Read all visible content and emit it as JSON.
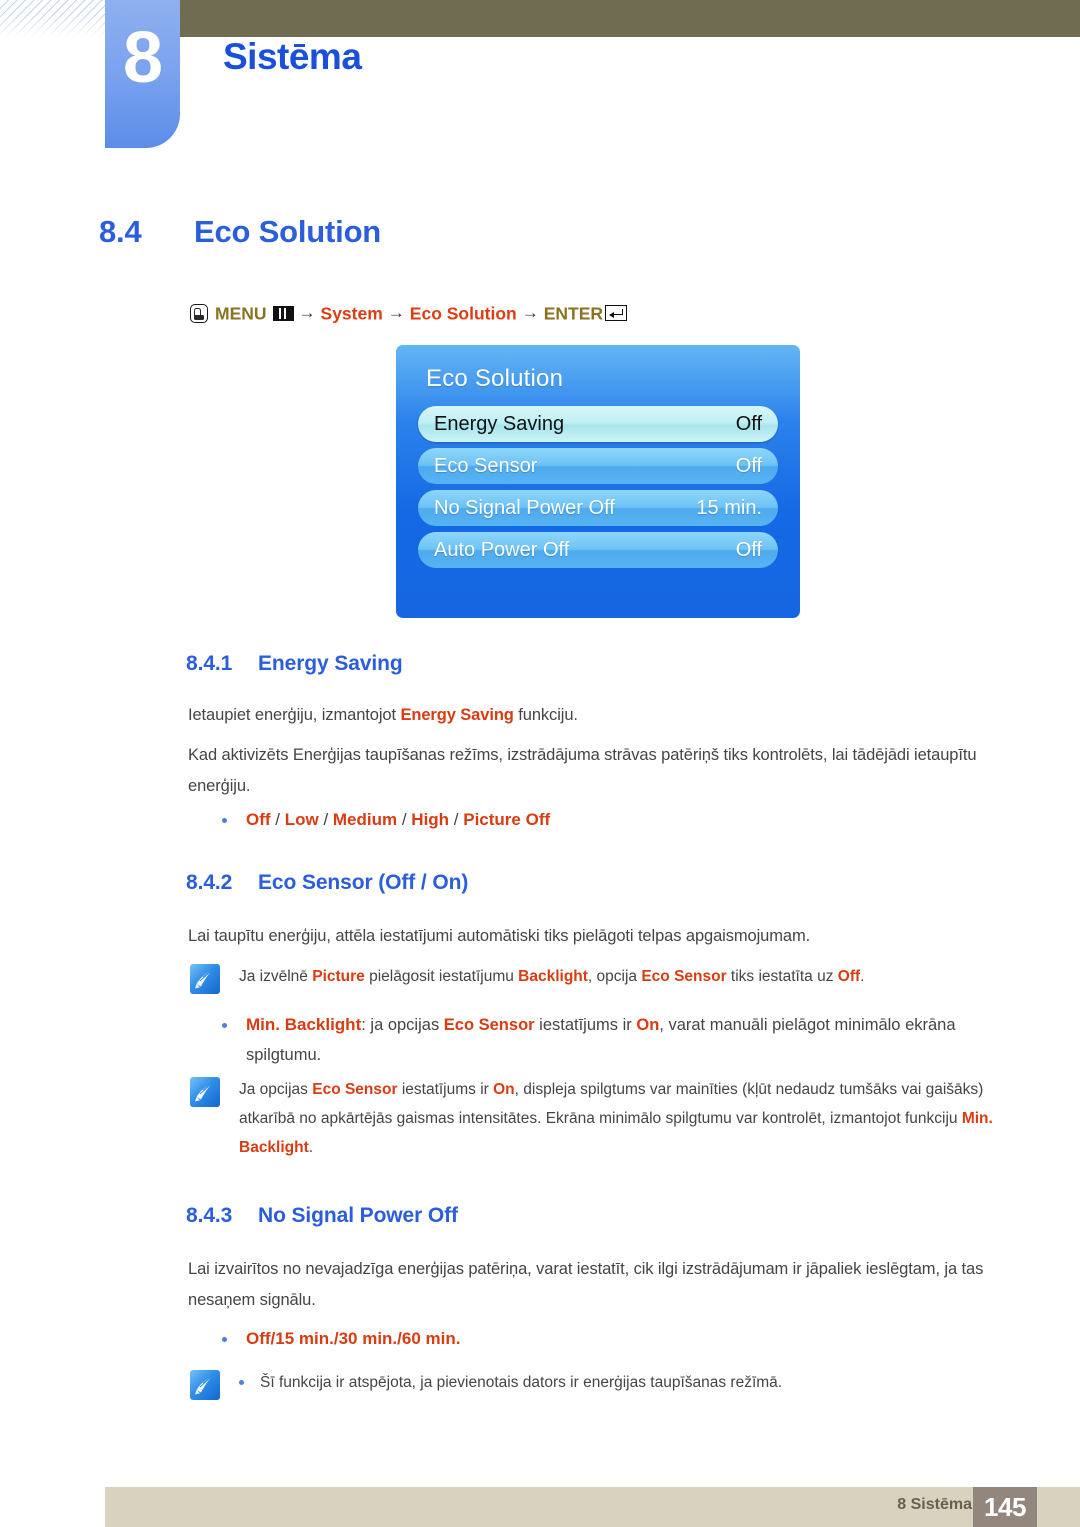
{
  "chapter": {
    "number": "8",
    "title": "Sistēma"
  },
  "section": {
    "number": "8.4",
    "title": "Eco Solution"
  },
  "menu_path": {
    "hand_icon": "hand-press-icon",
    "menu_label": "MENU",
    "menu_icon": "menu-grid-icon",
    "arrow1": "→",
    "system_label": "System",
    "arrow2": "→",
    "eco_solution_label": "Eco Solution",
    "arrow3": "→",
    "enter_label": "ENTER",
    "enter_icon": "enter-key-icon"
  },
  "osd": {
    "title": "Eco Solution",
    "rows": [
      {
        "label": "Energy Saving",
        "value": "Off",
        "selected": true
      },
      {
        "label": "Eco Sensor",
        "value": "Off",
        "selected": false
      },
      {
        "label": "No Signal Power Off",
        "value": "15 min.",
        "selected": false
      },
      {
        "label": "Auto Power Off",
        "value": "Off",
        "selected": false
      }
    ]
  },
  "s841": {
    "number": "8.4.1",
    "title": "Energy Saving",
    "p1_a": "Ietaupiet enerģiju, izmantojot ",
    "p1_b": "Energy Saving",
    "p1_c": " funkciju.",
    "p2": "Kad aktivizēts Enerģijas taupīšanas režīms, izstrādājuma strāvas patēriņš tiks kontrolēts, lai tādējādi ietaupītu enerģiju.",
    "options": "Off / Low / Medium / High / Picture Off",
    "option_items": [
      "Off",
      "Low",
      "Medium",
      "High",
      "Picture Off"
    ]
  },
  "s842": {
    "number": "8.4.2",
    "title": "Eco Sensor (Off / On)",
    "p1": "Lai taupītu enerģiju, attēla iestatījumi automātiski tiks pielāgoti telpas apgaismojumam.",
    "note1_a": "Ja izvēlnē ",
    "note1_picture": "Picture",
    "note1_b": " pielāgosit iestatījumu ",
    "note1_backlight": "Backlight",
    "note1_c": ", opcija ",
    "note1_ecosensor": "Eco Sensor",
    "note1_d": " tiks iestatīta uz ",
    "note1_off": "Off",
    "note1_e": ".",
    "bullet_a": "Min. Backlight",
    "bullet_b": ": ja opcijas ",
    "bullet_ecosensor": "Eco Sensor",
    "bullet_c": " iestatījums ir ",
    "bullet_on": "On",
    "bullet_d": ", varat manuāli pielāgot minimālo ekrāna spilgtumu.",
    "note2_a": "Ja opcijas ",
    "note2_ecosensor": "Eco Sensor",
    "note2_b": " iestatījums ir ",
    "note2_on": "On",
    "note2_c": ", displeja spilgtums var mainīties (kļūt nedaudz tumšāks vai gaišāks) atkarībā no apkārtējās gaismas intensitātes. Ekrāna minimālo spilgtumu var kontrolēt, izmantojot funkciju ",
    "note2_minbacklight": "Min. Backlight",
    "note2_d": "."
  },
  "s843": {
    "number": "8.4.3",
    "title": "No Signal Power Off",
    "p1": "Lai izvairītos no nevajadzīga enerģijas patēriņa, varat iestatīt, cik ilgi izstrādājumam ir jāpaliek ieslēgtam, ja tas nesaņem signālu.",
    "options": "Off/15 min./30 min./60 min.",
    "note": "Šī funkcija ir atspējota, ja pievienotais dators ir enerģijas taupīšanas režīmā."
  },
  "footer": {
    "label": "8 Sistēma",
    "page": "145"
  },
  "colors": {
    "accent_blue": "#2a5edd",
    "chapter_blue": "#1a4fdc",
    "red": "#d93c12",
    "gold": "#8a7320",
    "khaki": "#706c51",
    "footer_bar": "#d8d2be",
    "footer_page": "#93867c"
  }
}
